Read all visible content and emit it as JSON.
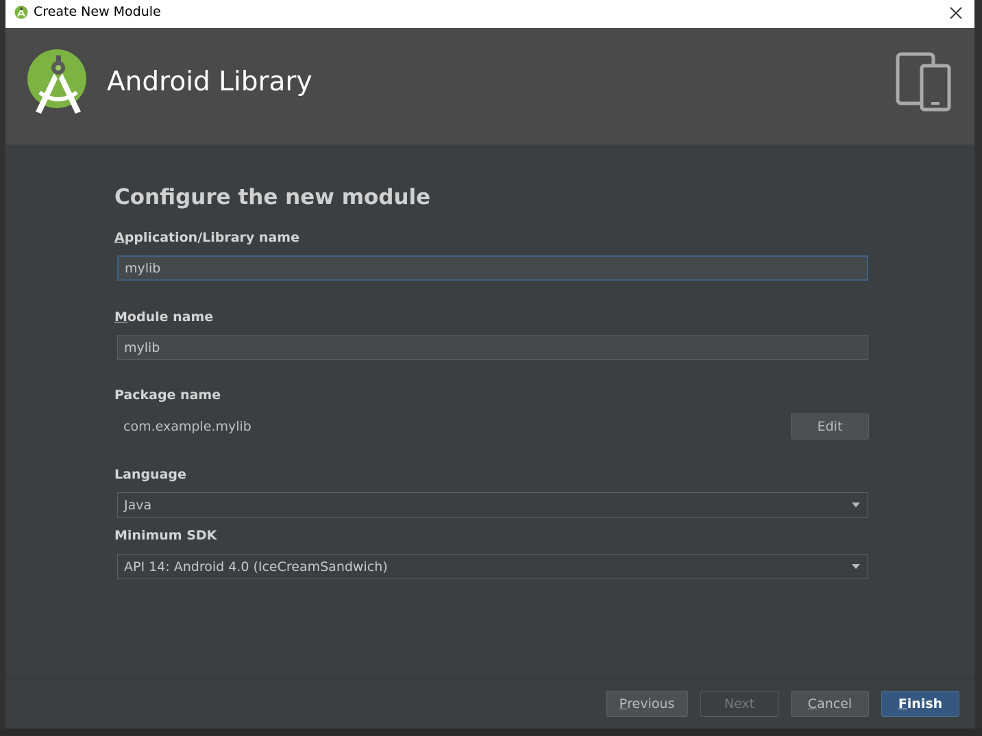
{
  "window": {
    "title": "Create New Module"
  },
  "banner": {
    "title": "Android Library"
  },
  "form": {
    "section_title": "Configure the new module",
    "app_name": {
      "label_mnemonic": "A",
      "label_rest": "pplication/Library name",
      "value": "mylib"
    },
    "module_name": {
      "label_mnemonic": "M",
      "label_rest": "odule name",
      "value": "mylib"
    },
    "package_name": {
      "label": "Package name",
      "value": "com.example.mylib",
      "edit_label": "Edit"
    },
    "language": {
      "label": "Language",
      "selected": "Java"
    },
    "min_sdk": {
      "label": "Minimum SDK",
      "selected": "API 14: Android 4.0 (IceCreamSandwich)"
    }
  },
  "footer": {
    "previous": {
      "mnemonic": "P",
      "rest": "revious"
    },
    "next": "Next",
    "cancel": {
      "mnemonic": "C",
      "rest": "ancel"
    },
    "finish": {
      "mnemonic": "F",
      "rest": "inish"
    }
  },
  "colors": {
    "dialog_bg": "#3c3f41",
    "banner_bg": "#4a4a4a",
    "primary_button": "#365880",
    "focus_border": "#3d6185",
    "android_green": "#7cb342"
  },
  "icons": {
    "app": "android-studio-icon",
    "close": "close-icon",
    "logo": "android-studio-logo",
    "device": "phone-tablet-icon",
    "dropdown": "chevron-down-icon"
  }
}
